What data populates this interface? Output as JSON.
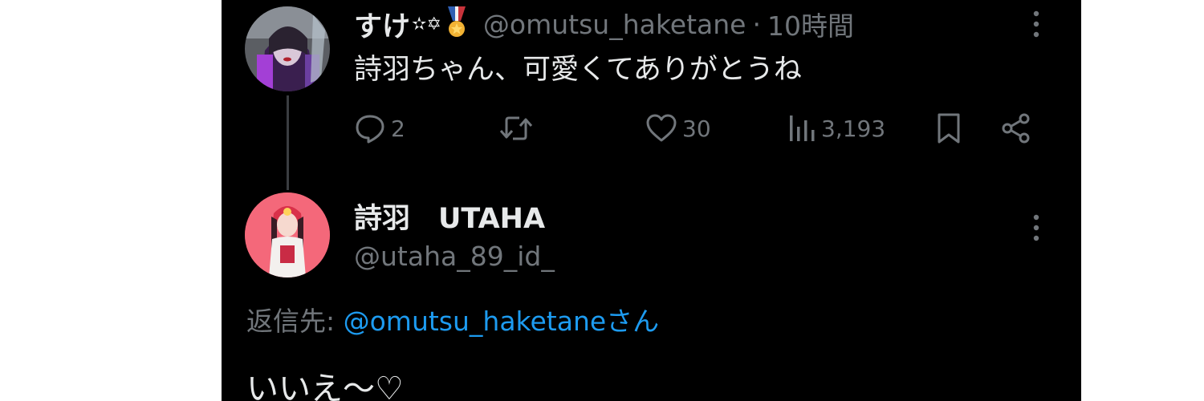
{
  "parent_tweet": {
    "display_name": "すけ",
    "name_decoration": "✫✡",
    "medal_icon": "medal-icon",
    "handle": "@omutsu_haketane",
    "separator": "·",
    "time": "10時間",
    "text": "詩羽ちゃん、可愛くてありがとうね",
    "actions": {
      "reply_count": "2",
      "retweet_count": "",
      "like_count": "30",
      "view_count": "3,193"
    },
    "icons": [
      "reply-icon",
      "retweet-icon",
      "heart-icon",
      "views-icon",
      "bookmark-icon",
      "share-icon",
      "more-icon"
    ]
  },
  "reply_tweet": {
    "display_name": "詩羽　UTAHA",
    "handle": "@utaha_89_id_",
    "reply_to_prefix": "返信先: ",
    "reply_to_handle": "@omutsu_haketaneさん",
    "text": "いいえ〜♡"
  },
  "colors": {
    "background": "#000000",
    "text_primary": "#e7e9ea",
    "text_secondary": "#71767b",
    "link": "#1d9bf0",
    "thread_line": "#3a3d41"
  }
}
